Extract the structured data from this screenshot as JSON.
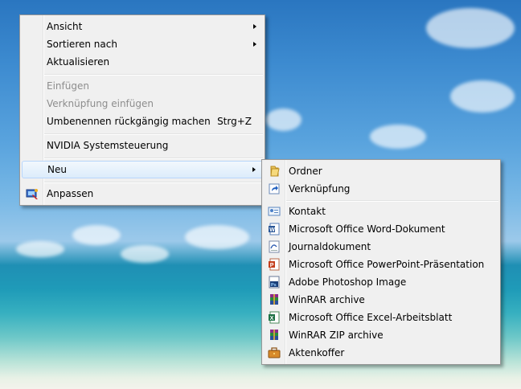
{
  "main_menu": {
    "items": [
      {
        "label": "Ansicht",
        "submenu": true
      },
      {
        "label": "Sortieren nach",
        "submenu": true
      },
      {
        "label": "Aktualisieren"
      },
      {
        "label": "Einfügen",
        "disabled": true
      },
      {
        "label": "Verknüpfung einfügen",
        "disabled": true
      },
      {
        "label": "Umbenennen rückgängig machen",
        "shortcut": "Strg+Z"
      },
      {
        "label": "NVIDIA Systemsteuerung"
      },
      {
        "label": "Neu",
        "submenu": true,
        "highlighted": true
      },
      {
        "label": "Anpassen",
        "icon": "personalize-icon"
      }
    ]
  },
  "new_submenu": {
    "items": [
      {
        "label": "Ordner",
        "icon": "folder-icon"
      },
      {
        "label": "Verknüpfung",
        "icon": "shortcut-icon"
      },
      {
        "label": "Kontakt",
        "icon": "contact-icon"
      },
      {
        "label": "Microsoft Office Word-Dokument",
        "icon": "word-document-icon"
      },
      {
        "label": "Journaldokument",
        "icon": "journal-document-icon"
      },
      {
        "label": "Microsoft Office PowerPoint-Präsentation",
        "icon": "powerpoint-icon"
      },
      {
        "label": "Adobe Photoshop Image",
        "icon": "photoshop-icon"
      },
      {
        "label": "WinRAR archive",
        "icon": "winrar-icon"
      },
      {
        "label": "Microsoft Office Excel-Arbeitsblatt",
        "icon": "excel-icon"
      },
      {
        "label": "WinRAR ZIP archive",
        "icon": "winrar-zip-icon"
      },
      {
        "label": "Aktenkoffer",
        "icon": "briefcase-icon"
      }
    ]
  },
  "colors": {
    "menu_bg": "#f0f0f0",
    "hover_border": "#b8d6fb",
    "disabled_text": "#8d8d8d"
  }
}
